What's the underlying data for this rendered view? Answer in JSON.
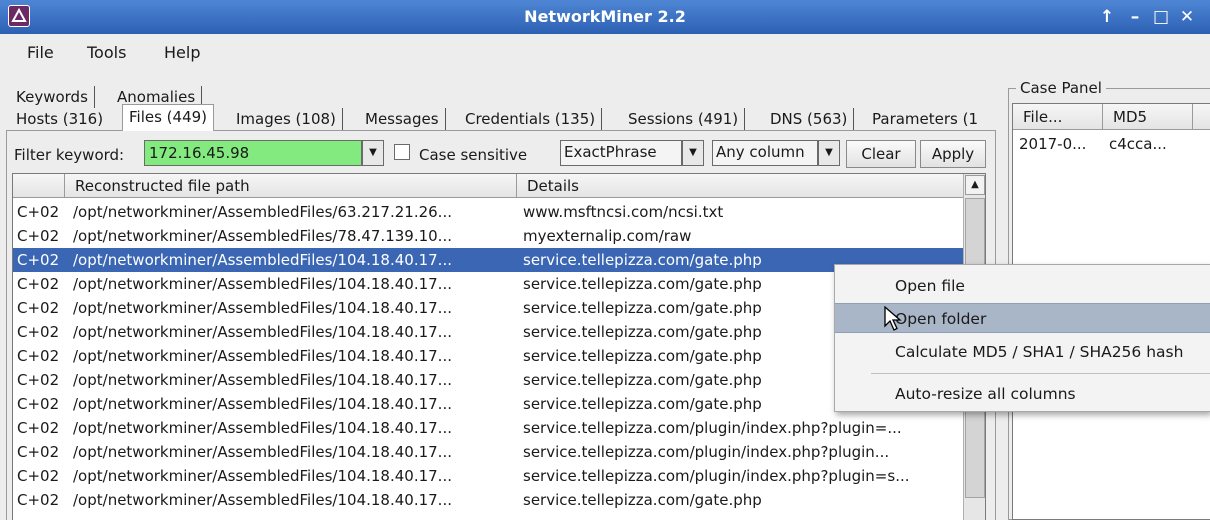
{
  "window": {
    "title": "NetworkMiner 2.2",
    "controls": [
      "↑",
      "–",
      "□",
      "✕"
    ]
  },
  "menu": [
    "File",
    "Tools",
    "Help"
  ],
  "tabs_row1": [
    "Keywords",
    "Anomalies"
  ],
  "tabs_row2": [
    "Hosts (316)",
    "Files (449)",
    "Images (108)",
    "Messages",
    "Credentials (135)",
    "Sessions (491)",
    "DNS (563)",
    "Parameters (1"
  ],
  "active_tab": "Files (449)",
  "filter": {
    "label": "Filter keyword:",
    "value": "172.16.45.98",
    "case_sensitive_label": "Case sensitive",
    "case_sensitive_checked": false,
    "match_mode": "ExactPhrase",
    "column_scope": "Any column",
    "clear_label": "Clear",
    "apply_label": "Apply",
    "highlight_color": "#82ea7e"
  },
  "table": {
    "columns": [
      "",
      "Reconstructed file path",
      "Details"
    ],
    "selected_row": 2,
    "rows": [
      {
        "c1": "C+02",
        "path": "/opt/networkminer/AssembledFiles/63.217.21.26...",
        "details": "www.msftncsi.com/ncsi.txt"
      },
      {
        "c1": "C+02",
        "path": "/opt/networkminer/AssembledFiles/78.47.139.10...",
        "details": "myexternalip.com/raw"
      },
      {
        "c1": "C+02",
        "path": "/opt/networkminer/AssembledFiles/104.18.40.17...",
        "details": "service.tellepizza.com/gate.php"
      },
      {
        "c1": "C+02",
        "path": "/opt/networkminer/AssembledFiles/104.18.40.17...",
        "details": "service.tellepizza.com/gate.php"
      },
      {
        "c1": "C+02",
        "path": "/opt/networkminer/AssembledFiles/104.18.40.17...",
        "details": "service.tellepizza.com/gate.php"
      },
      {
        "c1": "C+02",
        "path": "/opt/networkminer/AssembledFiles/104.18.40.17...",
        "details": "service.tellepizza.com/gate.php"
      },
      {
        "c1": "C+02",
        "path": "/opt/networkminer/AssembledFiles/104.18.40.17...",
        "details": "service.tellepizza.com/gate.php"
      },
      {
        "c1": "C+02",
        "path": "/opt/networkminer/AssembledFiles/104.18.40.17...",
        "details": "service.tellepizza.com/gate.php"
      },
      {
        "c1": "C+02",
        "path": "/opt/networkminer/AssembledFiles/104.18.40.17...",
        "details": "service.tellepizza.com/gate.php"
      },
      {
        "c1": "C+02",
        "path": "/opt/networkminer/AssembledFiles/104.18.40.17...",
        "details": "service.tellepizza.com/plugin/index.php?plugin=..."
      },
      {
        "c1": "C+02",
        "path": "/opt/networkminer/AssembledFiles/104.18.40.17...",
        "details": "service.tellepizza.com/plugin/index.php?plugin..."
      },
      {
        "c1": "C+02",
        "path": "/opt/networkminer/AssembledFiles/104.18.40.17...",
        "details": "service.tellepizza.com/plugin/index.php?plugin=s..."
      },
      {
        "c1": "C+02",
        "path": "/opt/networkminer/AssembledFiles/104.18.40.17...",
        "details": "service.tellepizza.com/gate.php"
      }
    ]
  },
  "case_panel": {
    "title": "Case Panel",
    "columns": [
      "File...",
      "MD5"
    ],
    "rows": [
      {
        "file": "2017-0...",
        "md5": "c4cca..."
      }
    ]
  },
  "context_menu": {
    "items": [
      "Open file",
      "Open folder",
      "Calculate MD5 / SHA1 / SHA256 hash",
      "Auto-resize all columns"
    ],
    "highlighted": "Open folder"
  }
}
